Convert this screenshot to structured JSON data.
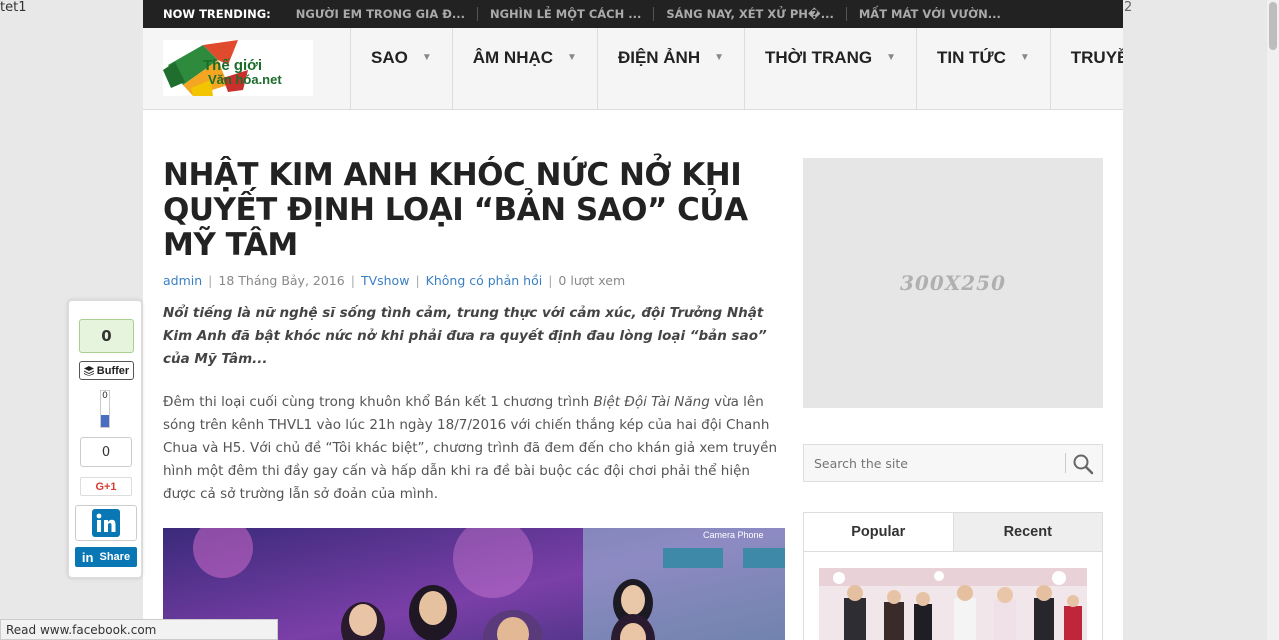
{
  "window": {
    "corner_left": "tet1",
    "corner_right": "2"
  },
  "trending": {
    "label": "NOW TRENDING:",
    "items": [
      "NGƯỜI EM TRONG GIA Đ...",
      "NGHÌN LẺ MỘT CÁCH ...",
      "SÁNG NAY, XÉT XỬ PH�...",
      "MẤT MÁT VỚI VƯỜN..."
    ]
  },
  "logo": {
    "line1": "Thế giới",
    "line2": "Văn hóa.net"
  },
  "nav": {
    "items": [
      {
        "label": "SAO"
      },
      {
        "label": "ÂM NHẠC"
      },
      {
        "label": "ĐIỆN ẢNH"
      },
      {
        "label": "THỜI TRANG"
      },
      {
        "label": "TIN TỨC"
      },
      {
        "label": "TRUYỀN HÌNH"
      }
    ],
    "caret": "▼"
  },
  "article": {
    "title": "NHẬT KIM ANH KHÓC NỨC NỞ KHI QUYẾT ĐỊNH LOẠI “BẢN SAO” CỦA MỸ TÂM",
    "meta": {
      "author": "admin",
      "date": "18 Tháng Bảy, 2016",
      "category": "TVshow",
      "comments": "Không có phản hồi",
      "views": "0 lượt xem",
      "separator": "|"
    },
    "lead": "Nổi tiếng là nữ nghệ sĩ sống tình cảm, trung thực với cảm xúc, đội Trưởng Nhật Kim Anh đã bật khóc nức nở khi phải đưa ra quyết định đau lòng loại “bản sao” của Mỹ Tâm...",
    "body_before": "Đêm thi loại cuối cùng trong khuôn khổ Bán kết 1 chương trình ",
    "body_show": "Biệt Đội Tài Năng",
    "body_after": " vừa lên sóng trên kênh THVL1 vào lúc 21h ngày 18/7/2016 với chiến thắng kép của hai đội Chanh Chua và H5. Với chủ đề “Tôi khác biệt”, chương trình đã đem đến cho khán giả xem truyền hình một đêm thi đầy gay cấn và hấp dẫn khi ra đề bài buộc các đội chơi phải thể hiện được cả sở trường lẫn sở đoản của mình.",
    "photo_caption_text": "Camera Phone"
  },
  "sidebar": {
    "ad_label": "300X250",
    "search_placeholder": "Search the site",
    "tabs": [
      {
        "label": "Popular"
      },
      {
        "label": "Recent"
      }
    ]
  },
  "share": {
    "facebook_count": "0",
    "buffer_label": "Buffer",
    "buffer_count": "0",
    "gplus_count": "0",
    "gplus_label": "G+1",
    "linkedin_label": "Share"
  },
  "status_bar": {
    "text": "Read www.facebook.com"
  },
  "colors": {
    "accent_link": "#3b7fc4",
    "trending_bg": "#222222",
    "linkedin": "#0a77b5",
    "gplus": "#d73d32",
    "buffer_fill": "#4a6cc3"
  }
}
